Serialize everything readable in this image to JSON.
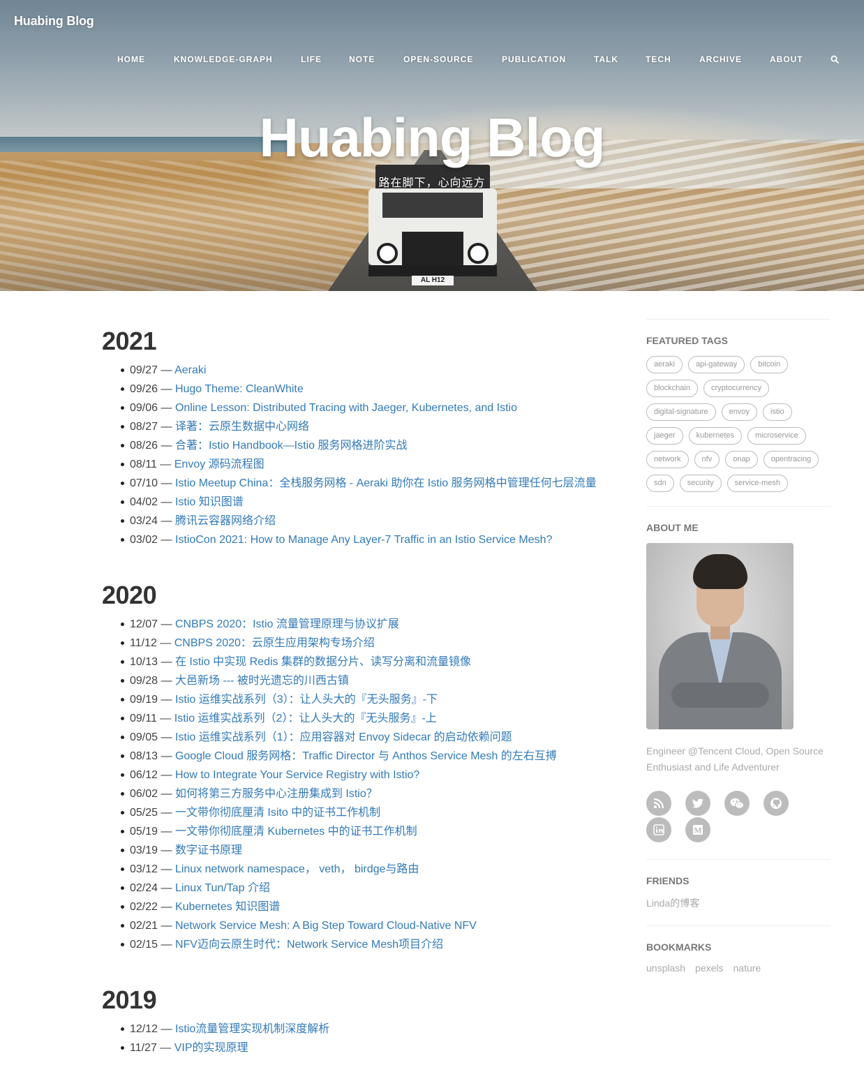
{
  "header": {
    "brand": "Huabing Blog",
    "nav": [
      "HOME",
      "KNOWLEDGE-GRAPH",
      "LIFE",
      "NOTE",
      "OPEN-SOURCE",
      "PUBLICATION",
      "TALK",
      "TECH",
      "ARCHIVE",
      "ABOUT"
    ],
    "title": "Huabing Blog",
    "subtitle": "路在脚下，心向远方",
    "plate": "AL H12"
  },
  "archive": [
    {
      "year": "2021",
      "posts": [
        {
          "date": "09/27",
          "title": "Aeraki"
        },
        {
          "date": "09/26",
          "title": "Hugo Theme: CleanWhite"
        },
        {
          "date": "09/06",
          "title": "Online Lesson: Distributed Tracing with Jaeger, Kubernetes, and Istio"
        },
        {
          "date": "08/27",
          "title": "译著：云原生数据中心网络"
        },
        {
          "date": "08/26",
          "title": "合著：Istio Handbook—Istio 服务网格进阶实战"
        },
        {
          "date": "08/11",
          "title": "Envoy 源码流程图"
        },
        {
          "date": "07/10",
          "title": "Istio Meetup China：全栈服务网格 - Aeraki 助你在 Istio 服务网格中管理任何七层流量"
        },
        {
          "date": "04/02",
          "title": "Istio 知识图谱"
        },
        {
          "date": "03/24",
          "title": "腾讯云容器网络介绍"
        },
        {
          "date": "03/02",
          "title": "IstioCon 2021: How to Manage Any Layer-7 Traffic in an Istio Service Mesh?"
        }
      ]
    },
    {
      "year": "2020",
      "posts": [
        {
          "date": "12/07",
          "title": "CNBPS 2020：Istio 流量管理原理与协议扩展"
        },
        {
          "date": "11/12",
          "title": "CNBPS 2020：云原生应用架构专场介绍"
        },
        {
          "date": "10/13",
          "title": "在 Istio 中实现 Redis 集群的数据分片、读写分离和流量镜像"
        },
        {
          "date": "09/28",
          "title": "大邑新场 --- 被时光遗忘的川西古镇"
        },
        {
          "date": "09/19",
          "title": "Istio 运维实战系列（3）：让人头大的『无头服务』-下"
        },
        {
          "date": "09/11",
          "title": "Istio 运维实战系列（2）：让人头大的『无头服务』-上"
        },
        {
          "date": "09/05",
          "title": "Istio 运维实战系列（1）：应用容器对 Envoy Sidecar 的启动依赖问题"
        },
        {
          "date": "08/13",
          "title": "Google Cloud 服务网格：Traffic Director 与 Anthos Service Mesh 的左右互搏"
        },
        {
          "date": "06/12",
          "title": "How to Integrate Your Service Registry with Istio?"
        },
        {
          "date": "06/02",
          "title": "如何将第三方服务中心注册集成到 Istio？"
        },
        {
          "date": "05/25",
          "title": "一文带你彻底厘清 Isito 中的证书工作机制"
        },
        {
          "date": "05/19",
          "title": "一文带你彻底厘清 Kubernetes 中的证书工作机制"
        },
        {
          "date": "03/19",
          "title": "数字证书原理"
        },
        {
          "date": "03/12",
          "title": "Linux network namespace， veth， birdge与路由"
        },
        {
          "date": "02/24",
          "title": "Linux Tun/Tap 介绍"
        },
        {
          "date": "02/22",
          "title": "Kubernetes 知识图谱"
        },
        {
          "date": "02/21",
          "title": "Network Service Mesh: A Big Step Toward Cloud-Native NFV"
        },
        {
          "date": "02/15",
          "title": "NFV迈向云原生时代：Network Service Mesh项目介绍"
        }
      ]
    },
    {
      "year": "2019",
      "posts": [
        {
          "date": "12/12",
          "title": "Istio流量管理实现机制深度解析"
        },
        {
          "date": "11/27",
          "title": "VIP的实现原理"
        }
      ]
    }
  ],
  "sidebar": {
    "featured_tags_title": "FEATURED TAGS",
    "tags": [
      "aeraki",
      "api-gateway",
      "bitcoin",
      "blockchain",
      "cryptocurrency",
      "digital-signature",
      "envoy",
      "istio",
      "jaeger",
      "kubernetes",
      "microservice",
      "network",
      "nfv",
      "onap",
      "opentracing",
      "sdn",
      "security",
      "service-mesh"
    ],
    "about_title": "ABOUT ME",
    "bio": "Engineer @Tencent Cloud, Open Source Enthusiast and Life Adventurer",
    "social_icons": [
      "rss-icon",
      "twitter-icon",
      "wechat-icon",
      "github-icon",
      "linkedin-icon",
      "medium-icon"
    ],
    "friends_title": "FRIENDS",
    "friends": [
      "Linda的博客"
    ],
    "bookmarks_title": "BOOKMARKS",
    "bookmarks": [
      "unsplash",
      "pexels",
      "nature"
    ],
    "colors": {
      "link": "#337ab7",
      "text": "#404040",
      "muted": "#aaaaaa",
      "icon_bg": "#bcbcbc"
    }
  }
}
